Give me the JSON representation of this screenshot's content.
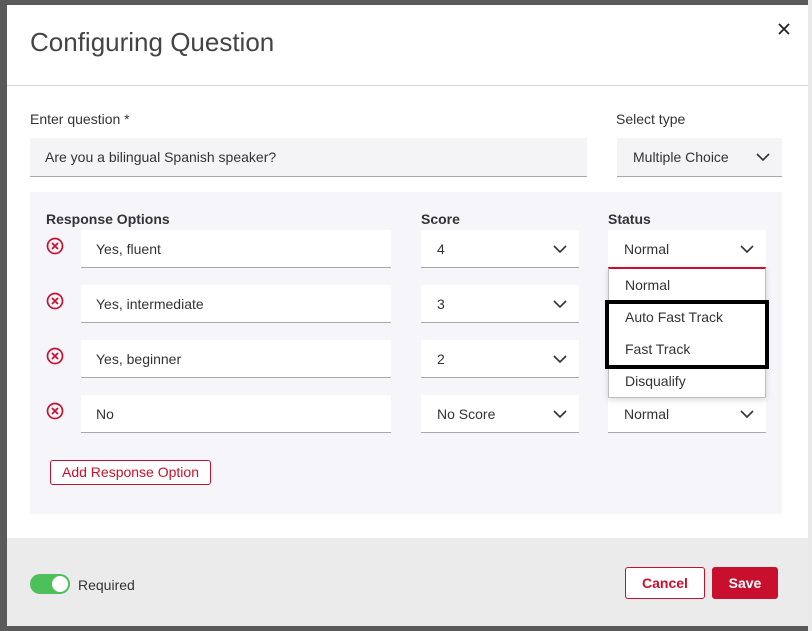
{
  "modal": {
    "title": "Configuring Question",
    "close_label": "×"
  },
  "question": {
    "label": "Enter question *",
    "value": "Are you a bilingual Spanish speaker?"
  },
  "type": {
    "label": "Select type",
    "value": "Multiple Choice"
  },
  "options": {
    "headers": {
      "response": "Response Options",
      "score": "Score",
      "status": "Status"
    },
    "rows": [
      {
        "response": "Yes, fluent",
        "score": "4",
        "status": "Normal"
      },
      {
        "response": "Yes, intermediate",
        "score": "3",
        "status": ""
      },
      {
        "response": "Yes, beginner",
        "score": "2",
        "status": ""
      },
      {
        "response": "No",
        "score": "No Score",
        "status": "Normal"
      }
    ],
    "add_label": "Add Response Option"
  },
  "status_dropdown": {
    "items": [
      "Normal",
      "Auto Fast Track",
      "Fast Track",
      "Disqualify"
    ]
  },
  "footer": {
    "required_label": "Required",
    "required_on": true,
    "cancel_label": "Cancel",
    "save_label": "Save"
  },
  "colors": {
    "brand": "#c8102e",
    "toggle_on": "#4cc15a",
    "panel_bg": "#f6f6fa",
    "footer_bg": "#ebebeb"
  },
  "icons": [
    "close-icon",
    "remove-circle-icon",
    "chevron-down-icon"
  ]
}
